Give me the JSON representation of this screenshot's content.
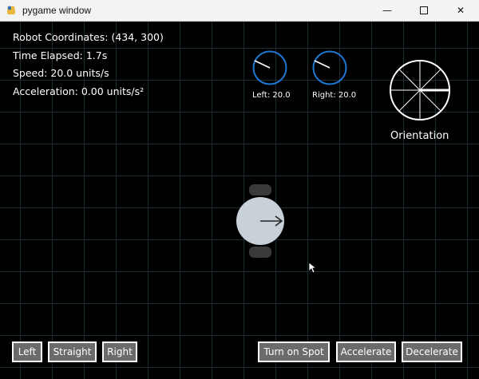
{
  "window": {
    "title": "pygame window"
  },
  "info": {
    "coordinates": "Robot Coordinates: (434, 300)",
    "time": "Time Elapsed: 1.7s",
    "speed": "Speed: 20.0 units/s",
    "acceleration": "Acceleration: 0.00 units/s²"
  },
  "dials": {
    "left_label": "Left: 20.0",
    "right_label": "Right: 20.0",
    "orientation_label": "Orientation"
  },
  "buttons": {
    "left": "Left",
    "straight": "Straight",
    "right": "Right",
    "turn_on_spot": "Turn on Spot",
    "accelerate": "Accelerate",
    "decelerate": "Decelerate"
  },
  "colors": {
    "dial_ring": "#1e78d2",
    "button_bg": "#6b6b6b",
    "robot_body": "#c8d0d8",
    "grid": "#1b2c33"
  }
}
